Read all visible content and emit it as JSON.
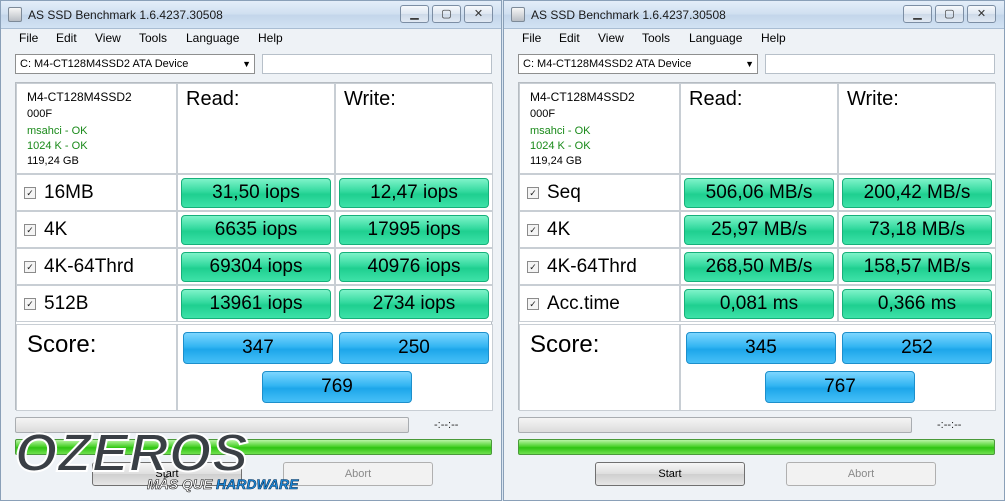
{
  "colors": {
    "result_green": "#32d99e",
    "score_blue": "#33b5f2",
    "ok_green": "#1a8a1a",
    "progress_green": "#2fc412"
  },
  "windows": [
    {
      "title": "AS SSD Benchmark 1.6.4237.30508",
      "menu": [
        "File",
        "Edit",
        "View",
        "Tools",
        "Language",
        "Help"
      ],
      "drive": "C: M4-CT128M4SSD2 ATA Device",
      "info": {
        "model": "M4-CT128M4SSD2",
        "firmware": "000F",
        "driver": "msahci - OK",
        "alignment": "1024 K - OK",
        "size": "119,24 GB"
      },
      "read_header": "Read:",
      "write_header": "Write:",
      "rows": [
        {
          "label": "16MB",
          "read": "31,50 iops",
          "write": "12,47 iops"
        },
        {
          "label": "4K",
          "read": "6635 iops",
          "write": "17995 iops"
        },
        {
          "label": "4K-64Thrd",
          "read": "69304 iops",
          "write": "40976 iops"
        },
        {
          "label": "512B",
          "read": "13961 iops",
          "write": "2734 iops"
        }
      ],
      "score_label": "Score:",
      "score_read": "347",
      "score_write": "250",
      "score_total": "769",
      "time": "-:--:--",
      "start_label": "Start",
      "abort_label": "Abort",
      "watermark": {
        "main": "OZEROS",
        "sub_white": "MÁS QUE",
        "sub_blue": "HARDWARE"
      }
    },
    {
      "title": "AS SSD Benchmark 1.6.4237.30508",
      "menu": [
        "File",
        "Edit",
        "View",
        "Tools",
        "Language",
        "Help"
      ],
      "drive": "C: M4-CT128M4SSD2 ATA Device",
      "info": {
        "model": "M4-CT128M4SSD2",
        "firmware": "000F",
        "driver": "msahci - OK",
        "alignment": "1024 K - OK",
        "size": "119,24 GB"
      },
      "read_header": "Read:",
      "write_header": "Write:",
      "rows": [
        {
          "label": "Seq",
          "read": "506,06 MB/s",
          "write": "200,42 MB/s"
        },
        {
          "label": "4K",
          "read": "25,97 MB/s",
          "write": "73,18 MB/s"
        },
        {
          "label": "4K-64Thrd",
          "read": "268,50 MB/s",
          "write": "158,57 MB/s"
        },
        {
          "label": "Acc.time",
          "read": "0,081 ms",
          "write": "0,366 ms"
        }
      ],
      "score_label": "Score:",
      "score_read": "345",
      "score_write": "252",
      "score_total": "767",
      "time": "-:--:--",
      "start_label": "Start",
      "abort_label": "Abort"
    }
  ]
}
